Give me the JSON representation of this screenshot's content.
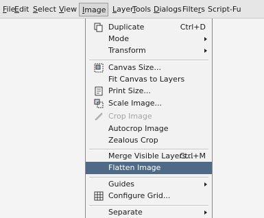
{
  "menubar": {
    "items": [
      {
        "label": "File",
        "mnemonic": "F"
      },
      {
        "label": "Edit",
        "mnemonic": "E"
      },
      {
        "label": "Select",
        "mnemonic": "S"
      },
      {
        "label": "View",
        "mnemonic": "V"
      },
      {
        "label": "Image",
        "mnemonic": "I",
        "active": true
      },
      {
        "label": "Layer",
        "mnemonic": "L"
      },
      {
        "label": "Tools",
        "mnemonic": "T"
      },
      {
        "label": "Dialogs",
        "mnemonic": "D"
      },
      {
        "label": "Filters",
        "mnemonic": "r"
      },
      {
        "label": "Script-Fu",
        "mnemonic": ""
      }
    ]
  },
  "image_menu": {
    "items": [
      {
        "label": "Duplicate",
        "shortcut": "Ctrl+D",
        "icon": "duplicate-icon"
      },
      {
        "label": "Mode",
        "submenu": true
      },
      {
        "label": "Transform",
        "submenu": true
      },
      {
        "separator": true
      },
      {
        "label": "Canvas Size...",
        "icon": "canvas-size-icon"
      },
      {
        "label": "Fit Canvas to Layers"
      },
      {
        "label": "Print Size...",
        "icon": "print-size-icon"
      },
      {
        "label": "Scale Image...",
        "icon": "scale-image-icon"
      },
      {
        "label": "Crop Image",
        "icon": "crop-icon",
        "disabled": true
      },
      {
        "label": "Autocrop Image"
      },
      {
        "label": "Zealous Crop"
      },
      {
        "separator": true
      },
      {
        "label": "Merge Visible Layers...",
        "shortcut": "Ctrl+M"
      },
      {
        "label": "Flatten Image",
        "highlighted": true
      },
      {
        "separator": true
      },
      {
        "label": "Guides",
        "submenu": true
      },
      {
        "label": "Configure Grid...",
        "icon": "grid-icon"
      },
      {
        "separator": true
      },
      {
        "label": "Separate",
        "submenu": true
      }
    ]
  },
  "colors": {
    "highlight": "#4e6a86",
    "menu_background": "#f2f2f2",
    "disabled_text": "#a4a4a4"
  }
}
